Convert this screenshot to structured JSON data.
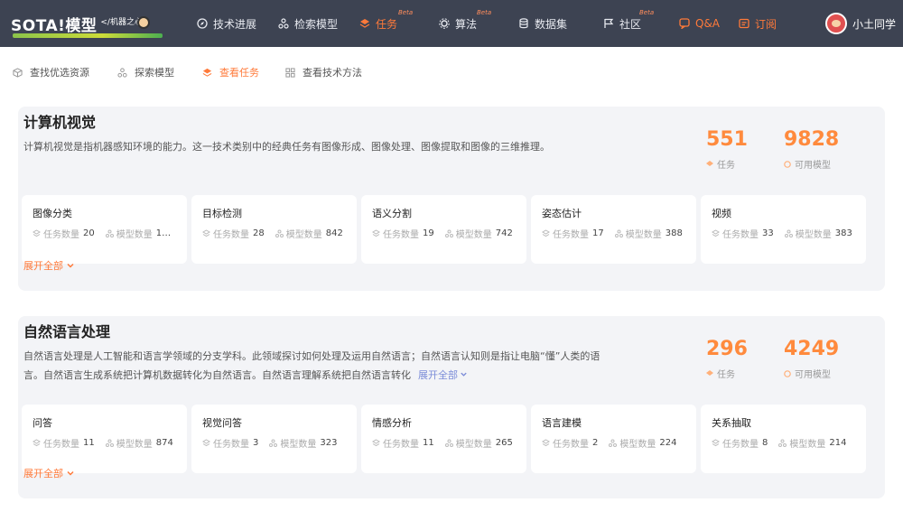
{
  "header": {
    "logo_text": "SOTA!模型",
    "logo_sub": "</机器之心>",
    "nav": [
      {
        "label": "技术进展",
        "icon": "compass-icon",
        "beta": ""
      },
      {
        "label": "检索模型",
        "icon": "nodes-icon",
        "beta": ""
      },
      {
        "label": "任务",
        "icon": "layers-icon",
        "beta": "Beta"
      },
      {
        "label": "算法",
        "icon": "gear-icon",
        "beta": "Beta"
      },
      {
        "label": "数据集",
        "icon": "database-icon",
        "beta": ""
      },
      {
        "label": "社区",
        "icon": "flag-icon",
        "beta": "Beta"
      },
      {
        "label": "Q&A",
        "icon": "qa-icon",
        "beta": ""
      },
      {
        "label": "订阅",
        "icon": "subscribe-icon",
        "beta": ""
      }
    ],
    "user_name": "小土同学"
  },
  "subtabs": [
    {
      "label": "查找优选资源"
    },
    {
      "label": "探索模型"
    },
    {
      "label": "查看任务"
    },
    {
      "label": "查看技术方法"
    }
  ],
  "sections": [
    {
      "title": "计算机视觉",
      "description": "计算机视觉是指机器感知环境的能力。这一技术类别中的经典任务有图像形成、图像处理、图像提取和图像的三维推理。",
      "expand_inline": "",
      "task_count": "551",
      "task_label": "任务",
      "model_count": "9828",
      "model_label": "可用模型",
      "cards": [
        {
          "title": "图像分类",
          "task_key": "任务数量",
          "tasks": "20",
          "model_key": "模型数量",
          "models": "1…"
        },
        {
          "title": "目标检测",
          "task_key": "任务数量",
          "tasks": "28",
          "model_key": "模型数量",
          "models": "842"
        },
        {
          "title": "语义分割",
          "task_key": "任务数量",
          "tasks": "19",
          "model_key": "模型数量",
          "models": "742"
        },
        {
          "title": "姿态估计",
          "task_key": "任务数量",
          "tasks": "17",
          "model_key": "模型数量",
          "models": "388"
        },
        {
          "title": "视频",
          "task_key": "任务数量",
          "tasks": "33",
          "model_key": "模型数量",
          "models": "383"
        }
      ],
      "expand_all": "展开全部"
    },
    {
      "title": "自然语言处理",
      "description": "自然语言处理是人工智能和语言学领域的分支学科。此领域探讨如何处理及运用自然语言；自然语言认知则是指让电脑“懂”人类的语言。自然语言生成系统把计算机数据转化为自然语言。自然语言理解系统把自然语言转化",
      "expand_inline": "展开全部",
      "task_count": "296",
      "task_label": "任务",
      "model_count": "4249",
      "model_label": "可用模型",
      "cards": [
        {
          "title": "问答",
          "task_key": "任务数量",
          "tasks": "11",
          "model_key": "模型数量",
          "models": "874"
        },
        {
          "title": "视觉问答",
          "task_key": "任务数量",
          "tasks": "3",
          "model_key": "模型数量",
          "models": "323"
        },
        {
          "title": "情感分析",
          "task_key": "任务数量",
          "tasks": "11",
          "model_key": "模型数量",
          "models": "265"
        },
        {
          "title": "语言建模",
          "task_key": "任务数量",
          "tasks": "2",
          "model_key": "模型数量",
          "models": "224"
        },
        {
          "title": "关系抽取",
          "task_key": "任务数量",
          "tasks": "8",
          "model_key": "模型数量",
          "models": "214"
        }
      ],
      "expand_all": "展开全部"
    }
  ],
  "colors": {
    "topbar": "#3d4352",
    "accent": "#ff7a3a",
    "stat": "#ff8a3d",
    "section_bg": "#f3f4f7"
  }
}
